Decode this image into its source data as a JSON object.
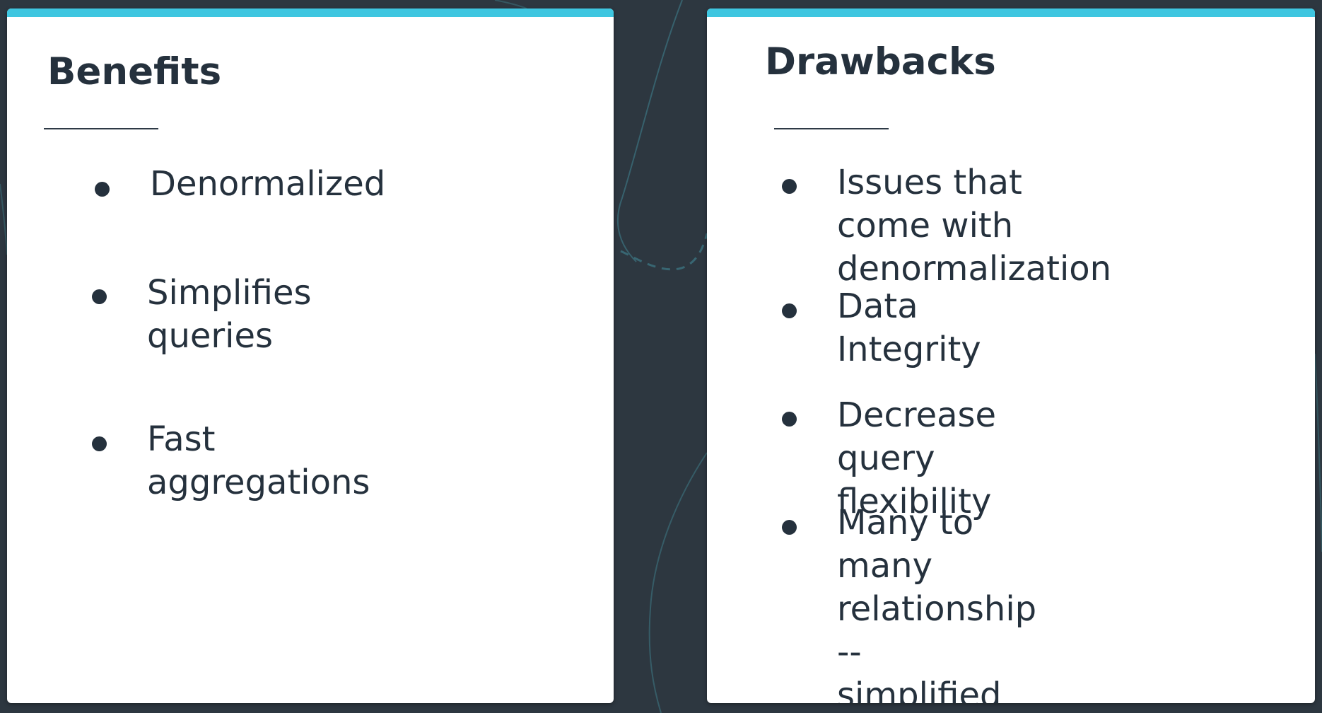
{
  "colors": {
    "background": "#2d3740",
    "card": "#ffffff",
    "accent_bar": "#3ec6e0",
    "text": "#25313d"
  },
  "benefits": {
    "title": "Benefits",
    "items": [
      {
        "text": "Denormalized"
      },
      {
        "text": "Simplifies\nqueries"
      },
      {
        "text": "Fast\naggregations"
      }
    ]
  },
  "drawbacks": {
    "title": "Drawbacks",
    "items": [
      {
        "text": "Issues that come with\ndenormalization"
      },
      {
        "text": "Data Integrity"
      },
      {
        "text": "Decrease query flexibility"
      },
      {
        "text": "Many to many relationship\n-- simplified"
      }
    ]
  }
}
